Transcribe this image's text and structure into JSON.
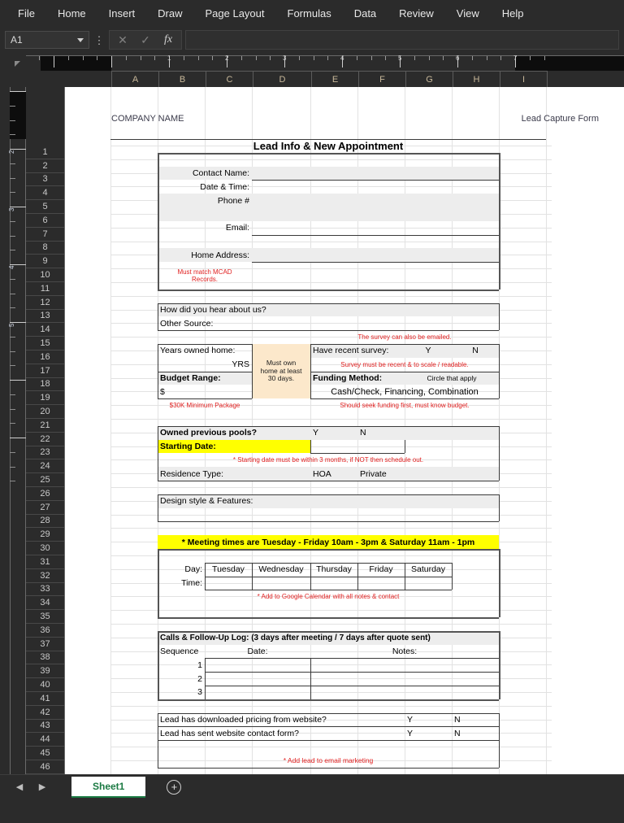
{
  "ribbon": {
    "tabs": [
      "File",
      "Home",
      "Insert",
      "Draw",
      "Page Layout",
      "Formulas",
      "Data",
      "Review",
      "View",
      "Help"
    ]
  },
  "formula_bar": {
    "namebox_value": "A1",
    "cancel_icon": "✕",
    "confirm_icon": "✓",
    "function_icon": "fx",
    "formula_value": "",
    "kebab_icon": "⋮",
    "caret_icon": "chevron-down"
  },
  "ruler": {
    "h_numbers": [
      "1",
      "2",
      "3",
      "4",
      "5",
      "6",
      "7"
    ],
    "v_numbers": [
      "2",
      "3",
      "4",
      "5"
    ]
  },
  "columns": [
    "A",
    "B",
    "C",
    "D",
    "E",
    "F",
    "G",
    "H",
    "I"
  ],
  "rows_visible": {
    "first": 1,
    "last": 46
  },
  "page_header": {
    "company": "COMPANY NAME",
    "form_label": "Lead Capture Form"
  },
  "form": {
    "title": "Lead Info & New Appointment",
    "contact": {
      "contact_name_label": "Contact Name:",
      "date_time_label": "Date & Time:",
      "phone_label": "Phone #",
      "email_label": "Email:",
      "home_address_label": "Home Address:",
      "mcad_note_line1": "Must match MCAD",
      "mcad_note_line2": "Records."
    },
    "source": {
      "hear_about_label": "How did you hear about us?",
      "other_source_label": "Other Source:"
    },
    "survey": {
      "emailed_note": "The survey can also be emailed.",
      "have_survey_label": "Have recent survey:",
      "yes": "Y",
      "no": "N",
      "recent_note": "Survey must be recent & to scale / readable."
    },
    "home_ownership": {
      "years_owned_label": "Years owned home:",
      "yrs_label": "YRS",
      "must_own_note_line1": "Must own",
      "must_own_note_line2": "home at least",
      "must_own_note_line3": "30 days.",
      "budget_label": "Budget Range:",
      "dollar": "$",
      "min_package_note": "$30K Minimum Package"
    },
    "funding": {
      "method_label": "Funding Method:",
      "circle_note": "Circle that apply",
      "options": "Cash/Check,    Financing,    Combination",
      "seek_note": "Should seek funding first, must know budget."
    },
    "pools": {
      "owned_pools_label": "Owned previous pools?",
      "yes": "Y",
      "no": "N",
      "starting_date_label": "Starting Date:",
      "starting_note": "* Starting date must be within 3 months, if NOT then schedule out.",
      "residence_label": "Residence Type:",
      "hoa": "HOA",
      "private": "Private"
    },
    "design": {
      "design_label": "Design style & Features:"
    },
    "meeting": {
      "banner": "* Meeting times are Tuesday - Friday 10am - 3pm & Saturday 11am - 1pm",
      "day_label": "Day:",
      "time_label": "Time:",
      "days": [
        "Tuesday",
        "Wednesday",
        "Thursday",
        "Friday",
        "Saturday"
      ],
      "times": [
        "",
        "",
        "",
        "",
        ""
      ],
      "calendar_note": "* Add to Google Calendar with all notes & contact"
    },
    "calls_log": {
      "header": "Calls & Follow-Up Log: (3 days after meeting / 7 days after quote sent)",
      "col_sequence": "Sequence",
      "col_date": "Date:",
      "col_notes": "Notes:",
      "rows": [
        {
          "seq": "1",
          "date": "",
          "notes": ""
        },
        {
          "seq": "2",
          "date": "",
          "notes": ""
        },
        {
          "seq": "3",
          "date": "",
          "notes": ""
        }
      ]
    },
    "website": {
      "downloaded_label": "Lead has downloaded pricing from website?",
      "contact_form_label": "Lead has sent website contact form?",
      "yes": "Y",
      "no": "N",
      "email_marketing_note": "* Add lead to email marketing"
    }
  },
  "tabbar": {
    "prev_icon": "◀",
    "next_icon": "▶",
    "sheet_name": "Sheet1",
    "add_icon": "+"
  },
  "colors": {
    "accent_red": "#e02020",
    "highlight_yellow": "#ffff00",
    "note_tan": "#fce8cb",
    "shade_gray": "#ededed",
    "sheet_tab_green": "#1b7a43"
  }
}
